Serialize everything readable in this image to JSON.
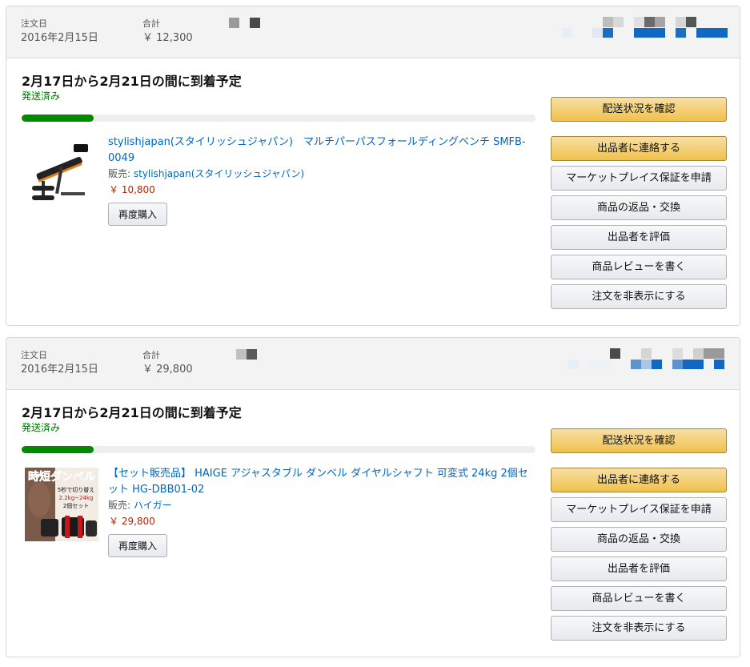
{
  "orders": [
    {
      "header": {
        "order_date_label": "注文日",
        "order_date": "2016年2月15日",
        "total_label": "合計",
        "total": "￥ 12,300"
      },
      "delivery_title": "2月17日から2月21日の間に到着予定",
      "status": "発送済み",
      "progress": 0.14,
      "item": {
        "title": "stylishjapan(スタイリッシュジャパン)　マルチパーパスフォールディングベンチ SMFB-0049",
        "seller_label": "販売:",
        "seller": "stylishjapan(スタイリッシュジャパン)",
        "price": "￥ 10,800",
        "buy_again_label": "再度購入"
      },
      "buttons": {
        "track": "配送状況を確認",
        "contact": "出品者に連絡する",
        "guarantee": "マーケットプレイス保証を申請",
        "return": "商品の返品・交換",
        "rate_seller": "出品者を評価",
        "review": "商品レビューを書く",
        "hide": "注文を非表示にする"
      }
    },
    {
      "header": {
        "order_date_label": "注文日",
        "order_date": "2016年2月15日",
        "total_label": "合計",
        "total": "￥ 29,800"
      },
      "delivery_title": "2月17日から2月21日の間に到着予定",
      "status": "発送済み",
      "progress": 0.14,
      "item": {
        "title": "【セット販売品】 HAIGE アジャスタブル ダンベル ダイヤルシャフト 可変式 24kg 2個セット HG-DBB01-02",
        "seller_label": "販売:",
        "seller": "ハイガー",
        "price": "￥ 29,800",
        "buy_again_label": "再度購入",
        "image_text": {
          "main": "時短ダンベル",
          "line1": "5秒で切り替え",
          "line2": "2.2kg~24kg",
          "line3": "2個セット"
        }
      },
      "buttons": {
        "track": "配送状況を確認",
        "contact": "出品者に連絡する",
        "guarantee": "マーケットプレイス保証を申請",
        "return": "商品の返品・交換",
        "rate_seller": "出品者を評価",
        "review": "商品レビューを書く",
        "hide": "注文を非表示にする"
      }
    }
  ],
  "colors": {
    "link": "#0066c0",
    "price": "#b12704",
    "status": "#007600",
    "progress": "#008a00",
    "primary_button": "#f0c14b"
  }
}
